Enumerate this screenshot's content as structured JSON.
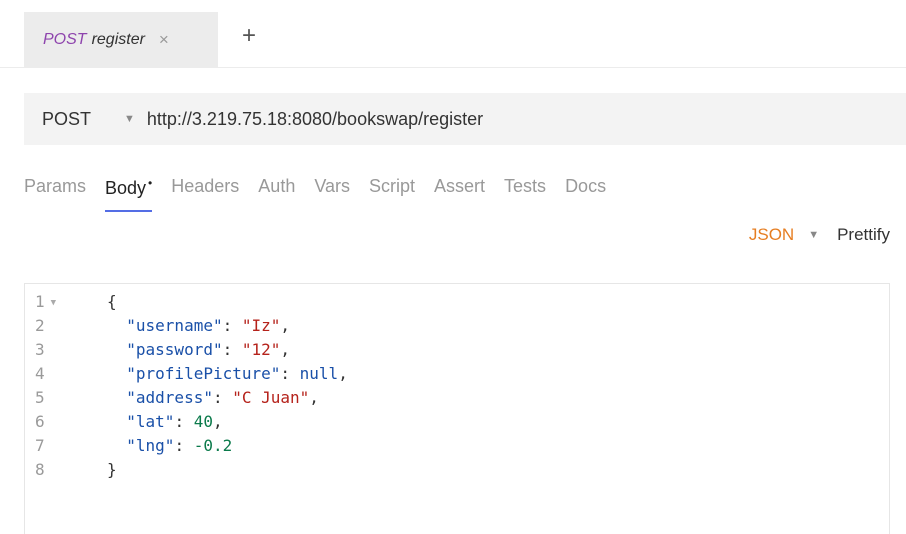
{
  "request_tab": {
    "method": "POST",
    "name": "register",
    "close_glyph": "×"
  },
  "new_tab_glyph": "+",
  "url_bar": {
    "method": "POST",
    "url": "http://3.219.75.18:8080/bookswap/register"
  },
  "pane_tabs": [
    {
      "label": "Params",
      "active": false
    },
    {
      "label": "Body",
      "active": true,
      "modified": "•"
    },
    {
      "label": "Headers",
      "active": false
    },
    {
      "label": "Auth",
      "active": false
    },
    {
      "label": "Vars",
      "active": false
    },
    {
      "label": "Script",
      "active": false
    },
    {
      "label": "Assert",
      "active": false
    },
    {
      "label": "Tests",
      "active": false
    },
    {
      "label": "Docs",
      "active": false
    }
  ],
  "body_mode": {
    "mode": "JSON",
    "prettify_label": "Prettify"
  },
  "editor": {
    "line_numbers": [
      "1",
      "2",
      "3",
      "4",
      "5",
      "6",
      "7",
      "8"
    ],
    "lines": [
      {
        "open": "{"
      },
      {
        "key": "\"username\"",
        "sep": ": ",
        "val": "\"Iz\"",
        "end": ","
      },
      {
        "key": "\"password\"",
        "sep": ": ",
        "val": "\"12\"",
        "end": ","
      },
      {
        "key": "\"profilePicture\"",
        "sep": ": ",
        "val": "null",
        "end": ","
      },
      {
        "key": "\"address\"",
        "sep": ": ",
        "val": "\"C Juan\"",
        "end": ","
      },
      {
        "key": "\"lat\"",
        "sep": ": ",
        "val": "40",
        "end": ","
      },
      {
        "key": "\"lng\"",
        "sep": ": ",
        "val": "-0.2",
        "end": ""
      },
      {
        "close": "}"
      }
    ]
  },
  "colors": {
    "method_purple": "#8e44ad",
    "json_orange": "#e67e22",
    "active_underline": "#546de5",
    "string_red": "#b5221b",
    "number_green": "#0b7a4b",
    "key_blue": "#1a50a8"
  }
}
